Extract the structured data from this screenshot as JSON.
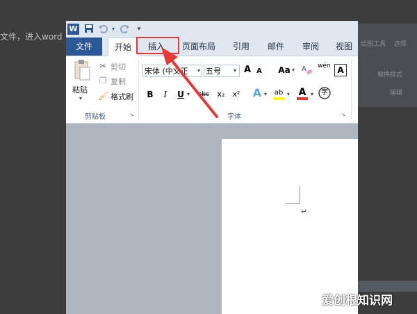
{
  "background": {
    "text": "文件，进入word"
  },
  "background_ribbon": {
    "label1": "绘图工具",
    "label2": "选择",
    "label3": "替换样式",
    "label4": "编辑"
  },
  "qat": {
    "app_icon": "W",
    "save": "save-icon",
    "undo": "undo-icon",
    "redo": "redo-icon",
    "more": "customize-icon"
  },
  "tabs": {
    "file": "文件",
    "home": "开始",
    "insert": "插入",
    "layout": "页面布局",
    "references": "引用",
    "mailings": "邮件",
    "review": "审阅",
    "view": "视图"
  },
  "clipboard": {
    "paste": "粘贴",
    "cut": "剪切",
    "copy": "复制",
    "format_painter": "格式刷",
    "group_label": "剪贴板"
  },
  "font": {
    "font_name": "宋体 (中文正",
    "font_size": "五号",
    "grow": "A",
    "shrink": "A",
    "change_case": "Aa",
    "phonetic": "wén",
    "border": "A",
    "bold": "B",
    "italic": "I",
    "underline": "U",
    "strike": "abc",
    "subscript": "x₂",
    "superscript": "x²",
    "effects": "A",
    "highlight": "ab",
    "color": "A",
    "encircle": "字",
    "group_label": "字体"
  },
  "doc": {
    "para_mark": "↵"
  },
  "colors": {
    "accent": "#2b5797",
    "highlight": "#e53935"
  },
  "watermark": "爱创根知识网"
}
